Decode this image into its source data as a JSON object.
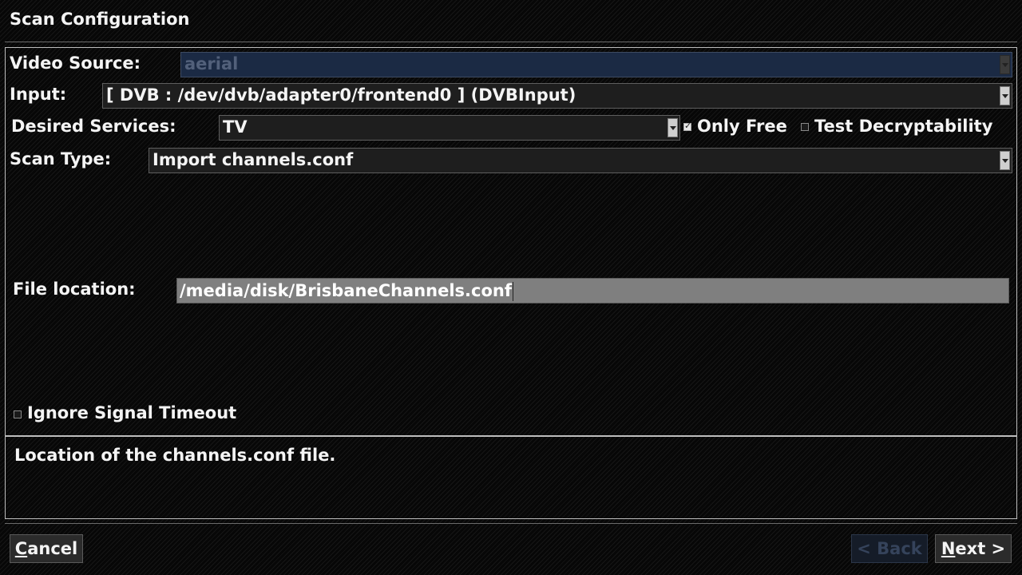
{
  "window": {
    "title": "Scan Configuration"
  },
  "form": {
    "video_source": {
      "label": "Video Source:",
      "value": "aerial"
    },
    "input": {
      "label": "Input:",
      "value": "[ DVB : /dev/dvb/adapter0/frontend0 ] (DVBInput)"
    },
    "desired_services": {
      "label": "Desired Services:",
      "value": "TV"
    },
    "only_free": {
      "label": "Only Free",
      "checked": true
    },
    "test_decryptability": {
      "label": "Test Decryptability",
      "checked": false
    },
    "scan_type": {
      "label": "Scan Type:",
      "value": "Import channels.conf"
    },
    "file_location": {
      "label": "File location:",
      "value": "/media/disk/BrisbaneChannels.conf"
    },
    "ignore_signal_timeout": {
      "label": "Ignore Signal Timeout",
      "checked": false
    }
  },
  "help": {
    "text": "Location of the channels.conf file."
  },
  "buttons": {
    "cancel": {
      "mnemonic": "C",
      "rest": "ancel"
    },
    "back": {
      "label": "< Back"
    },
    "next": {
      "mnemonic": "N",
      "rest": "ext >"
    }
  }
}
